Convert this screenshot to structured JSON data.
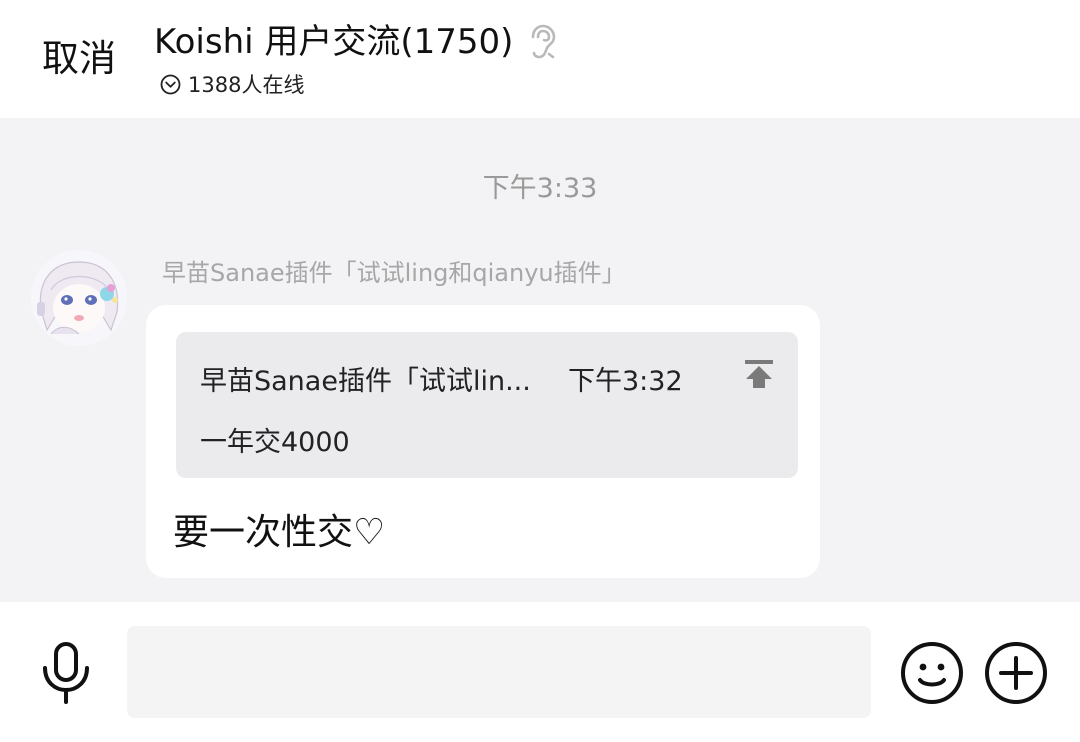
{
  "header": {
    "cancel_label": "取消",
    "title": "Koishi 用户交流(1750)",
    "online": "1388人在线"
  },
  "chat": {
    "timestamp": "下午3:33",
    "message": {
      "sender": "早苗Sanae插件「试试ling和qianyu插件」",
      "quote": {
        "sender": "早苗Sanae插件「试试lin...",
        "time": "下午3:32",
        "text": "一年交4000"
      },
      "text": "要一次性交♡"
    }
  },
  "input": {
    "placeholder": ""
  },
  "icons": {
    "title_icon": "ear-icon",
    "online_icon": "chevron-down-circle-icon",
    "quote_action": "jump-to-top-icon",
    "voice": "microphone-icon",
    "emoji": "smiley-icon",
    "more": "plus-circle-icon"
  },
  "colors": {
    "background": "#f3f2f4",
    "bubble": "#ffffff",
    "quote_background": "#ebeaed",
    "muted_text": "#a7a7a7"
  }
}
